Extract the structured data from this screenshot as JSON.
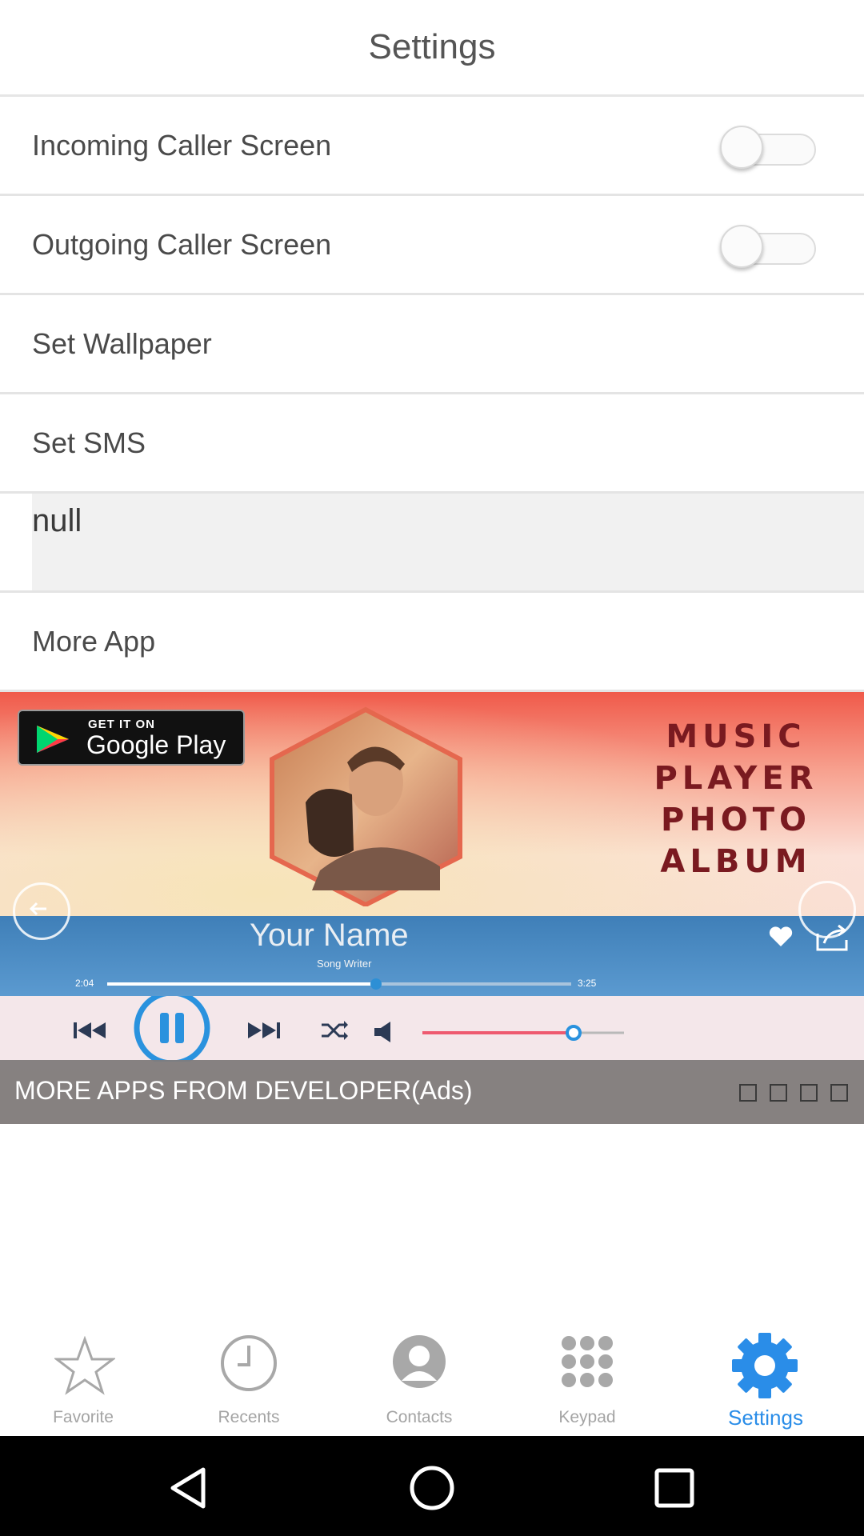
{
  "header": {
    "title": "Settings"
  },
  "rows": {
    "incoming": {
      "label": "Incoming Caller Screen",
      "toggle_on": false
    },
    "outgoing": {
      "label": "Outgoing Caller Screen",
      "toggle_on": false
    },
    "wallpaper": {
      "label": "Set Wallpaper"
    },
    "sms": {
      "label": "Set SMS"
    },
    "null_field": {
      "value": "null"
    },
    "more_app": {
      "label": "More App"
    }
  },
  "ad": {
    "badge_small": "GET IT ON",
    "badge_store": "Google Play",
    "title_lines": [
      "MUSIC",
      "PLAYER",
      "PHOTO",
      "ALBUM"
    ],
    "song_title": "Your Name",
    "song_writer": "Song Writer",
    "time_elapsed": "2:04",
    "time_total": "3:25",
    "progress_fraction": 0.58,
    "volume_fraction": 0.75,
    "more_apps_text": "MORE APPS FROM DEVELOPER(Ads)",
    "page_indicator_count": 4
  },
  "tabs": [
    {
      "label": "Favorite",
      "icon": "star-icon"
    },
    {
      "label": "Recents",
      "icon": "clock-icon"
    },
    {
      "label": "Contacts",
      "icon": "person-icon"
    },
    {
      "label": "Keypad",
      "icon": "keypad-icon"
    },
    {
      "label": "Settings",
      "icon": "gear-icon",
      "active": true
    }
  ],
  "colors": {
    "active_tab": "#2a8de8",
    "inactive_tab": "#a4a4a4"
  },
  "nav": {
    "back": "back-icon",
    "home": "home-icon",
    "recents": "overview-icon"
  }
}
